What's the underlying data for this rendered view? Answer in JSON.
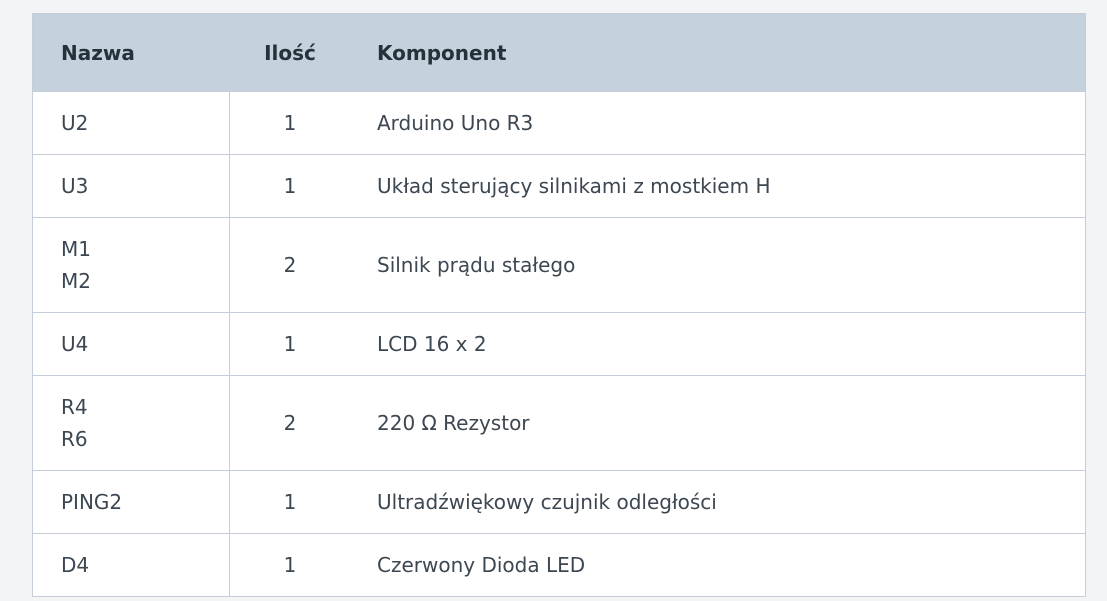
{
  "table": {
    "headers": {
      "name": "Nazwa",
      "qty": "Ilość",
      "component": "Komponent"
    },
    "rows": [
      {
        "names": [
          "U2"
        ],
        "qty": "1",
        "component": "Arduino Uno R3"
      },
      {
        "names": [
          "U3"
        ],
        "qty": "1",
        "component": "Układ sterujący silnikami z mostkiem H"
      },
      {
        "names": [
          "M1",
          "M2"
        ],
        "qty": "2",
        "component": "Silnik prądu stałego"
      },
      {
        "names": [
          "U4"
        ],
        "qty": "1",
        "component": "LCD 16 x 2"
      },
      {
        "names": [
          "R4",
          "R6"
        ],
        "qty": "2",
        "component": "220 Ω Rezystor"
      },
      {
        "names": [
          "PING2"
        ],
        "qty": "1",
        "component": "Ultradźwiękowy czujnik odległości"
      },
      {
        "names": [
          "D4"
        ],
        "qty": "1",
        "component": "Czerwony Dioda LED"
      }
    ]
  }
}
